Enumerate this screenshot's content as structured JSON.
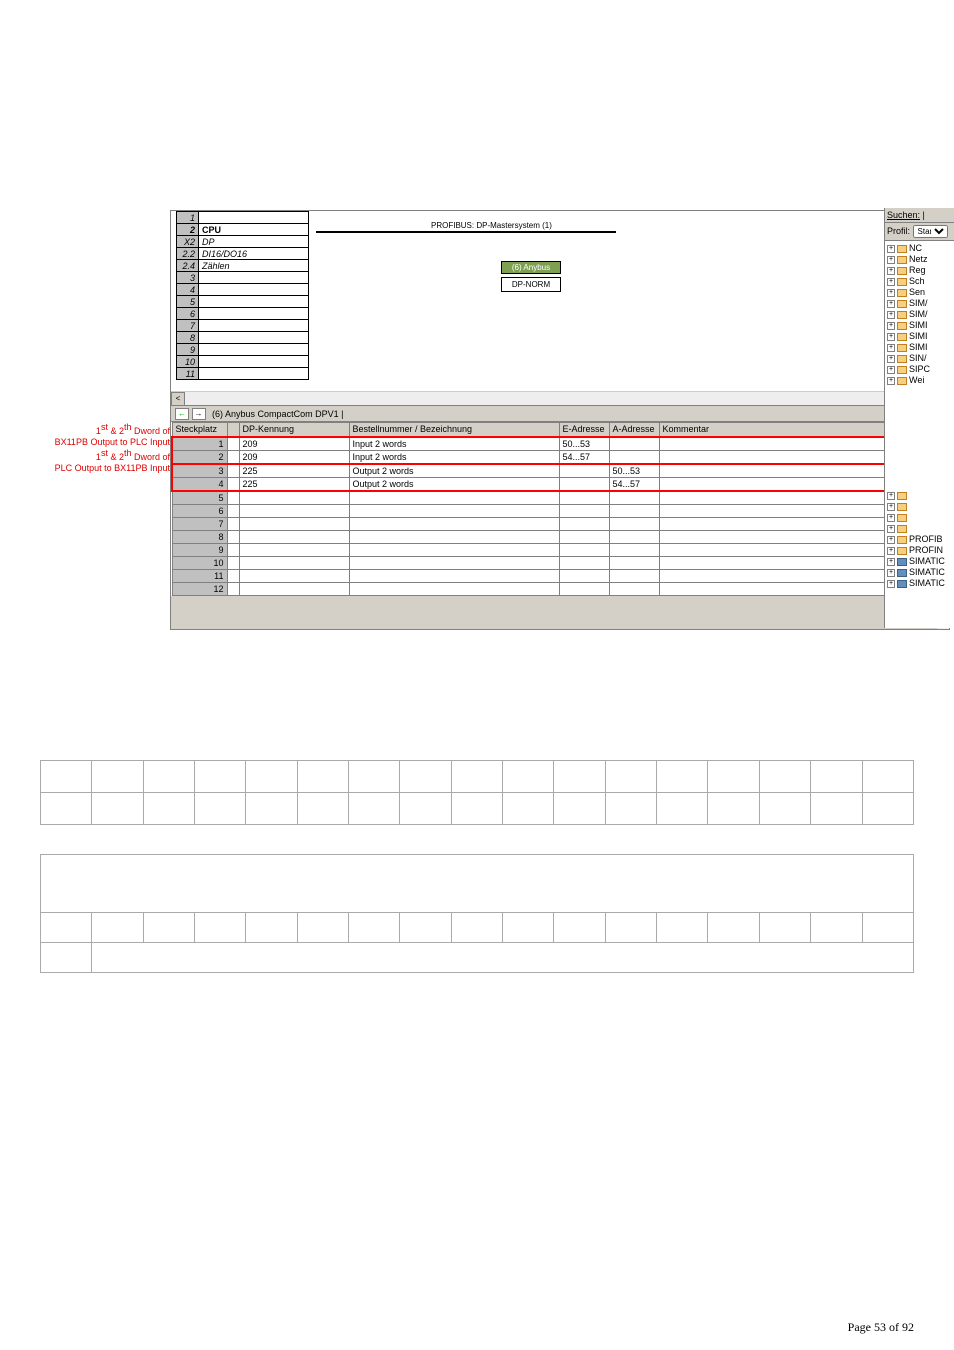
{
  "rack": {
    "slots": [
      {
        "num": "1",
        "name": ""
      },
      {
        "num": "2",
        "name": "CPU",
        "bold": true
      },
      {
        "num": "X2",
        "name": "DP",
        "italic": true
      },
      {
        "num": "2.2",
        "name": "DI16/DO16",
        "italic": true
      },
      {
        "num": "2.4",
        "name": "Zählen",
        "italic": true
      },
      {
        "num": "3",
        "name": ""
      },
      {
        "num": "4",
        "name": ""
      },
      {
        "num": "5",
        "name": ""
      },
      {
        "num": "6",
        "name": ""
      },
      {
        "num": "7",
        "name": ""
      },
      {
        "num": "8",
        "name": ""
      },
      {
        "num": "9",
        "name": ""
      },
      {
        "num": "10",
        "name": ""
      },
      {
        "num": "11",
        "name": ""
      }
    ]
  },
  "profibus_label": "PROFIBUS: DP-Mastersystem (1)",
  "anybus": {
    "head": "(6) Anybus",
    "body": "DP-NORM"
  },
  "nav_title": "(6)  Anybus CompactCom DPV1 |",
  "lower": {
    "headers": {
      "steck": "Steckplatz",
      "dp": "DP-Kennung",
      "bez": "Bestellnummer / Bezeichnung",
      "e": "E-Adresse",
      "a": "A-Adresse",
      "k": "Kommentar"
    },
    "rows": [
      {
        "slot": "1",
        "dp": "209",
        "bez": "Input 2 words",
        "e": "50...53",
        "a": "",
        "k": ""
      },
      {
        "slot": "2",
        "dp": "209",
        "bez": "Input 2 words",
        "e": "54...57",
        "a": "",
        "k": ""
      },
      {
        "slot": "3",
        "dp": "225",
        "bez": "Output 2 words",
        "e": "",
        "a": "50...53",
        "k": ""
      },
      {
        "slot": "4",
        "dp": "225",
        "bez": "Output 2 words",
        "e": "",
        "a": "54...57",
        "k": ""
      },
      {
        "slot": "5"
      },
      {
        "slot": "6"
      },
      {
        "slot": "7"
      },
      {
        "slot": "8"
      },
      {
        "slot": "9"
      },
      {
        "slot": "10"
      },
      {
        "slot": "11"
      },
      {
        "slot": "12"
      }
    ]
  },
  "left_labels": {
    "l1a": "1",
    "l1b": " & 2",
    "l1c": " Dword of",
    "sup": "st",
    "sup2": "th",
    "l2": "BX11PB Output to PLC Input",
    "l3a": "1",
    "l3b": " & 2",
    "l3c": " Dword of",
    "l4": "PLC Output to BX11PB Input"
  },
  "side": {
    "search": "Suchen:",
    "profile": "Profil:",
    "profile_val": "Stand",
    "tree1": [
      {
        "t": "NC"
      },
      {
        "t": "Netz"
      },
      {
        "t": "Reg"
      },
      {
        "t": "Sch"
      },
      {
        "t": "Sen"
      },
      {
        "t": "SIM/"
      },
      {
        "t": "SIM/"
      },
      {
        "t": "SIMI"
      },
      {
        "t": "SIMI"
      },
      {
        "t": "SIMI"
      },
      {
        "t": "SIN/"
      },
      {
        "t": "SIPC"
      },
      {
        "t": "Wei"
      }
    ],
    "tree2": [
      {
        "t": "",
        "cls": "yellow"
      },
      {
        "t": "",
        "cls": "yellow"
      },
      {
        "t": "",
        "cls": "yellow"
      },
      {
        "t": "",
        "cls": "yellow"
      },
      {
        "t": "PROFIB",
        "cls": "net"
      },
      {
        "t": "PROFIN",
        "cls": "net"
      },
      {
        "t": "SIMATIC",
        "cls": "simatic"
      },
      {
        "t": "SIMATIC",
        "cls": "simatic"
      },
      {
        "t": "SIMATIC",
        "cls": "simatic"
      }
    ]
  },
  "footer": "Page 53 of 92",
  "arrows": {
    "left": "<",
    "right": ">",
    "back": "←",
    "fwd": "→"
  }
}
